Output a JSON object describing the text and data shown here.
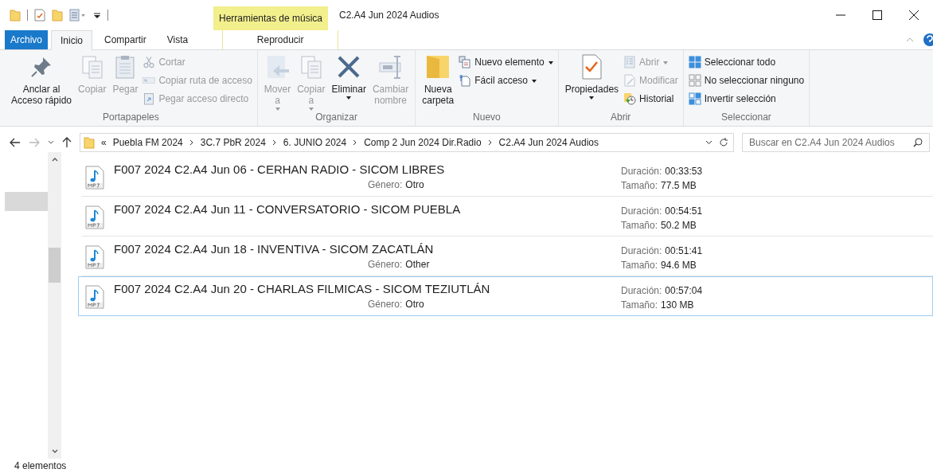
{
  "window": {
    "title": "C2.A4 Jun 2024 Audios"
  },
  "contextual_group": {
    "label": "Herramientas de música"
  },
  "tabs": [
    {
      "label": "Archivo",
      "kind": "file",
      "selected": false
    },
    {
      "label": "Inicio",
      "kind": "normal",
      "selected": true
    },
    {
      "label": "Compartir",
      "kind": "normal",
      "selected": false
    },
    {
      "label": "Vista",
      "kind": "normal",
      "selected": false
    },
    {
      "label": "Reproducir",
      "kind": "contextual",
      "selected": false
    }
  ],
  "ribbon": {
    "groups": [
      {
        "label": "Portapapeles",
        "commands": [
          {
            "label": "Anclar al\nAcceso rápido",
            "kind": "large",
            "disabled": false,
            "dropdown": false
          },
          {
            "label": "Copiar",
            "kind": "large",
            "disabled": true,
            "dropdown": false
          },
          {
            "label": "Pegar",
            "kind": "large",
            "disabled": true,
            "dropdown": false
          },
          {
            "label": "Cortar",
            "kind": "small",
            "disabled": true,
            "dropdown": false
          },
          {
            "label": "Copiar ruta de acceso",
            "kind": "small",
            "disabled": true,
            "dropdown": false
          },
          {
            "label": "Pegar acceso directo",
            "kind": "small",
            "disabled": true,
            "dropdown": false
          }
        ]
      },
      {
        "label": "Organizar",
        "commands": [
          {
            "label": "Mover\na",
            "kind": "large",
            "disabled": true,
            "dropdown": true
          },
          {
            "label": "Copiar\na",
            "kind": "large",
            "disabled": true,
            "dropdown": true
          },
          {
            "label": "Eliminar",
            "kind": "large",
            "disabled": false,
            "dropdown": true
          },
          {
            "label": "Cambiar\nnombre",
            "kind": "large",
            "disabled": true,
            "dropdown": false
          }
        ]
      },
      {
        "label": "Nuevo",
        "commands": [
          {
            "label": "Nueva\ncarpeta",
            "kind": "large",
            "disabled": false,
            "dropdown": false
          },
          {
            "label": "Nuevo elemento",
            "kind": "small",
            "disabled": false,
            "dropdown": true
          },
          {
            "label": "Fácil acceso",
            "kind": "small",
            "disabled": false,
            "dropdown": true
          }
        ]
      },
      {
        "label": "Abrir",
        "commands": [
          {
            "label": "Propiedades",
            "kind": "large",
            "disabled": false,
            "dropdown": true
          },
          {
            "label": "Abrir",
            "kind": "small",
            "disabled": true,
            "dropdown": true
          },
          {
            "label": "Modificar",
            "kind": "small",
            "disabled": true,
            "dropdown": false
          },
          {
            "label": "Historial",
            "kind": "small",
            "disabled": false,
            "dropdown": false
          }
        ]
      },
      {
        "label": "Seleccionar",
        "commands": [
          {
            "label": "Seleccionar todo",
            "kind": "small",
            "disabled": false,
            "dropdown": false
          },
          {
            "label": "No seleccionar ninguno",
            "kind": "small",
            "disabled": false,
            "dropdown": false
          },
          {
            "label": "Invertir selección",
            "kind": "small",
            "disabled": false,
            "dropdown": false
          }
        ]
      }
    ]
  },
  "address_bar": {
    "overflow": "«",
    "breadcrumbs": [
      "Puebla FM 2024",
      "3C.7 PbR 2024",
      "6. JUNIO 2024",
      "Comp 2 Jun 2024  Dir.Radio",
      "C2.A4 Jun 2024 Audios"
    ]
  },
  "search": {
    "placeholder": "Buscar en C2.A4 Jun 2024 Audios"
  },
  "files": [
    {
      "name": "F007 2024 C2.A4 Jun 06 - CERHAN RADIO - SICOM LIBRES",
      "genre": {
        "label": "Género:",
        "value": "Otro"
      },
      "duration": {
        "label": "Duración:",
        "value": "00:33:53"
      },
      "size": {
        "label": "Tamaño:",
        "value": "77.5 MB"
      },
      "selected": false
    },
    {
      "name": "F007 2024 C2.A4 Jun 11 - CONVERSATORIO - SICOM PUEBLA",
      "duration": {
        "label": "Duración:",
        "value": "00:54:51"
      },
      "size": {
        "label": "Tamaño:",
        "value": "50.2 MB"
      },
      "selected": false
    },
    {
      "name": "F007 2024 C2.A4 Jun 18 - INVENTIVA - SICOM ZACATLÁN",
      "genre": {
        "label": "Género:",
        "value": "Other"
      },
      "duration": {
        "label": "Duración:",
        "value": "00:51:41"
      },
      "size": {
        "label": "Tamaño:",
        "value": "94.6 MB"
      },
      "selected": false
    },
    {
      "name": "F007 2024 C2.A4 Jun 20 - CHARLAS FILMICAS - SICOM TEZIUTLÁN",
      "genre": {
        "label": "Género:",
        "value": "Otro"
      },
      "duration": {
        "label": "Duración:",
        "value": "00:57:04"
      },
      "size": {
        "label": "Tamaño:",
        "value": "130 MB"
      },
      "selected": true
    }
  ],
  "status_bar": {
    "text": "4 elementos"
  }
}
